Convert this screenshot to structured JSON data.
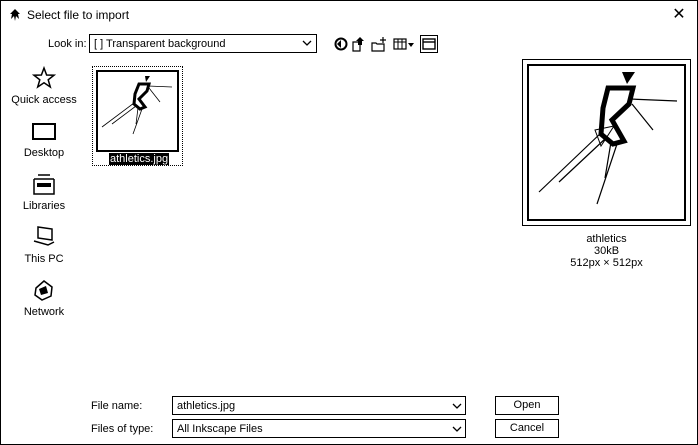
{
  "window": {
    "title": "Select file to import",
    "close_label": "✕"
  },
  "toolbar": {
    "look_in_label": "Look in:",
    "look_in_value": "[ ] Transparent background",
    "icons": [
      "back-icon",
      "up-folder-icon",
      "new-folder-icon",
      "view-menu-icon",
      "preview-toggle-icon"
    ]
  },
  "places": [
    {
      "label": "Quick access",
      "icon": "star-icon"
    },
    {
      "label": "Desktop",
      "icon": "desktop-icon"
    },
    {
      "label": "Libraries",
      "icon": "libraries-icon"
    },
    {
      "label": "This PC",
      "icon": "computer-icon"
    },
    {
      "label": "Network",
      "icon": "network-icon"
    }
  ],
  "files": [
    {
      "name": "athletics.jpg",
      "selected": true
    }
  ],
  "preview": {
    "name": "athletics",
    "size": "30kB",
    "dimensions": "512px × 512px"
  },
  "footer": {
    "file_name_label": "File name:",
    "file_name_value": "athletics.jpg",
    "file_type_label": "Files of type:",
    "file_type_value": "All Inkscape Files",
    "open_label": "Open",
    "cancel_label": "Cancel"
  }
}
